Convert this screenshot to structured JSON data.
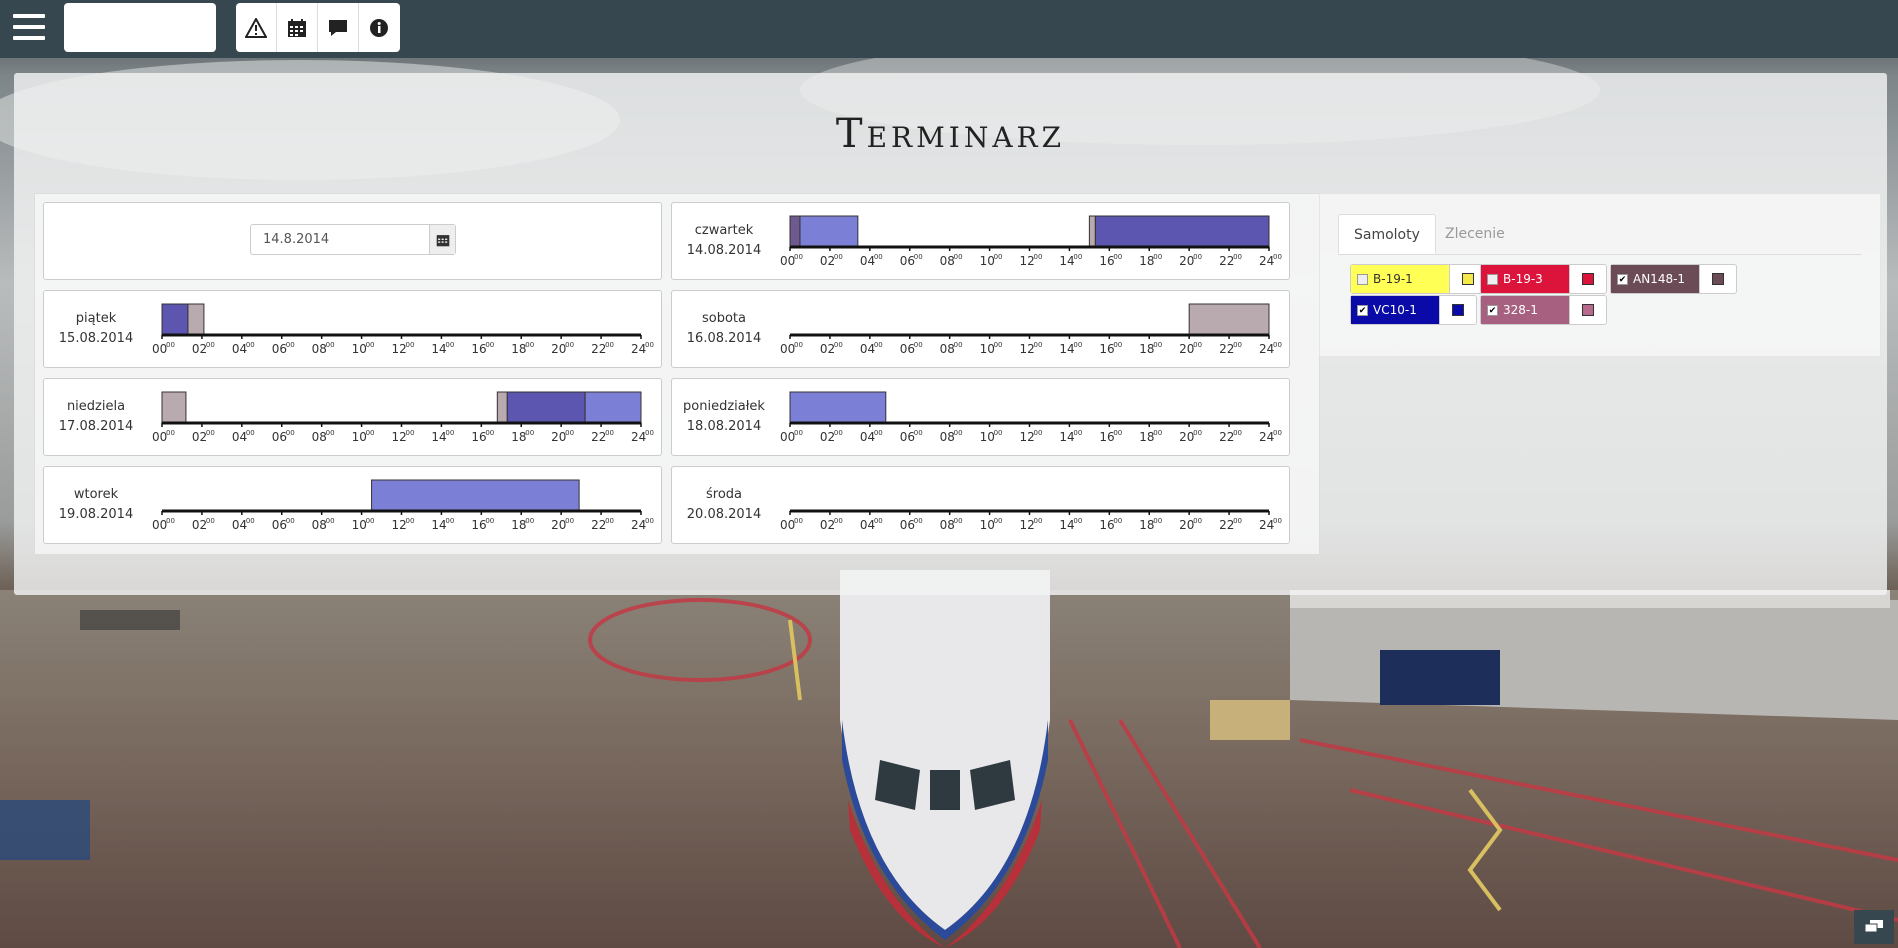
{
  "title": "Terminarz",
  "toolbar": {
    "icons": [
      "warning-icon",
      "calendar-icon",
      "comment-icon",
      "info-icon"
    ]
  },
  "date_picker": {
    "value": "14.8.2014"
  },
  "days": [
    {
      "name": "czwartek",
      "date": "14.08.2014",
      "bars": [
        {
          "start": 0.0,
          "end": 0.5,
          "color": "#6e5a8e"
        },
        {
          "start": 0.5,
          "end": 3.4,
          "color": "#7b7fd6"
        },
        {
          "start": 15.0,
          "end": 15.3,
          "color": "#b9aaaf"
        },
        {
          "start": 15.3,
          "end": 24.0,
          "color": "#5c56b0"
        }
      ]
    },
    {
      "name": "piątek",
      "date": "15.08.2014",
      "bars": [
        {
          "start": 0.0,
          "end": 1.3,
          "color": "#5c56b0"
        },
        {
          "start": 1.3,
          "end": 2.1,
          "color": "#b9aaaf"
        }
      ]
    },
    {
      "name": "sobota",
      "date": "16.08.2014",
      "bars": [
        {
          "start": 20.0,
          "end": 24.0,
          "color": "#b9aaaf"
        }
      ]
    },
    {
      "name": "niedziela",
      "date": "17.08.2014",
      "bars": [
        {
          "start": 0.0,
          "end": 1.2,
          "color": "#b9aaaf"
        },
        {
          "start": 16.8,
          "end": 17.3,
          "color": "#b9aaaf"
        },
        {
          "start": 17.3,
          "end": 21.2,
          "color": "#5c56b0"
        },
        {
          "start": 21.2,
          "end": 24.0,
          "color": "#7b7fd6"
        }
      ]
    },
    {
      "name": "poniedziałek",
      "date": "18.08.2014",
      "bars": [
        {
          "start": 0.0,
          "end": 4.8,
          "color": "#7b7fd6"
        }
      ]
    },
    {
      "name": "wtorek",
      "date": "19.08.2014",
      "bars": [
        {
          "start": 10.5,
          "end": 20.9,
          "color": "#7b7fd6"
        }
      ]
    },
    {
      "name": "środa",
      "date": "20.08.2014",
      "bars": []
    }
  ],
  "axis": {
    "ticks": [
      "00",
      "02",
      "04",
      "06",
      "08",
      "10",
      "12",
      "14",
      "16",
      "18",
      "20",
      "22",
      "24"
    ],
    "sup": "00"
  },
  "sidebar": {
    "tabs": [
      "Samoloty",
      "Zlecenie"
    ],
    "planes": [
      {
        "name": "B-19-1",
        "checked": false,
        "bg": "#ffff55",
        "text": "#333",
        "swatch": "#f5e84a"
      },
      {
        "name": "B-19-3",
        "checked": false,
        "bg": "#dc143c",
        "text": "#fff",
        "swatch": "#dc143c"
      },
      {
        "name": "AN148-1",
        "checked": true,
        "bg": "#6b4c56",
        "text": "#fff",
        "swatch": "#6b4c56"
      },
      {
        "name": "VC10-1",
        "checked": true,
        "bg": "#0a0aa8",
        "text": "#fff",
        "swatch": "#0a0aa8"
      },
      {
        "name": "328-1",
        "checked": true,
        "bg": "#a86080",
        "text": "#fff",
        "swatch": "#b86a8c"
      }
    ]
  }
}
